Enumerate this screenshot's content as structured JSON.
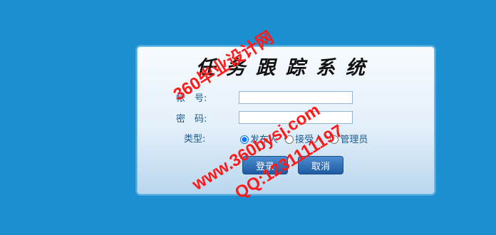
{
  "title": "任务跟踪系统",
  "form": {
    "account_label": "帐　号:",
    "account_value": "",
    "password_label": "密　码:",
    "password_value": "",
    "type_label": "类型:",
    "types": [
      {
        "label": "发布人",
        "checked": true
      },
      {
        "label": "接受人",
        "checked": false
      },
      {
        "label": "管理员",
        "checked": false
      }
    ],
    "login_label": "登录",
    "cancel_label": "取消"
  },
  "watermark": {
    "line1": "360毕业设计网",
    "line2": "www.360bysj.com",
    "line3": "QQ:1231111197"
  }
}
